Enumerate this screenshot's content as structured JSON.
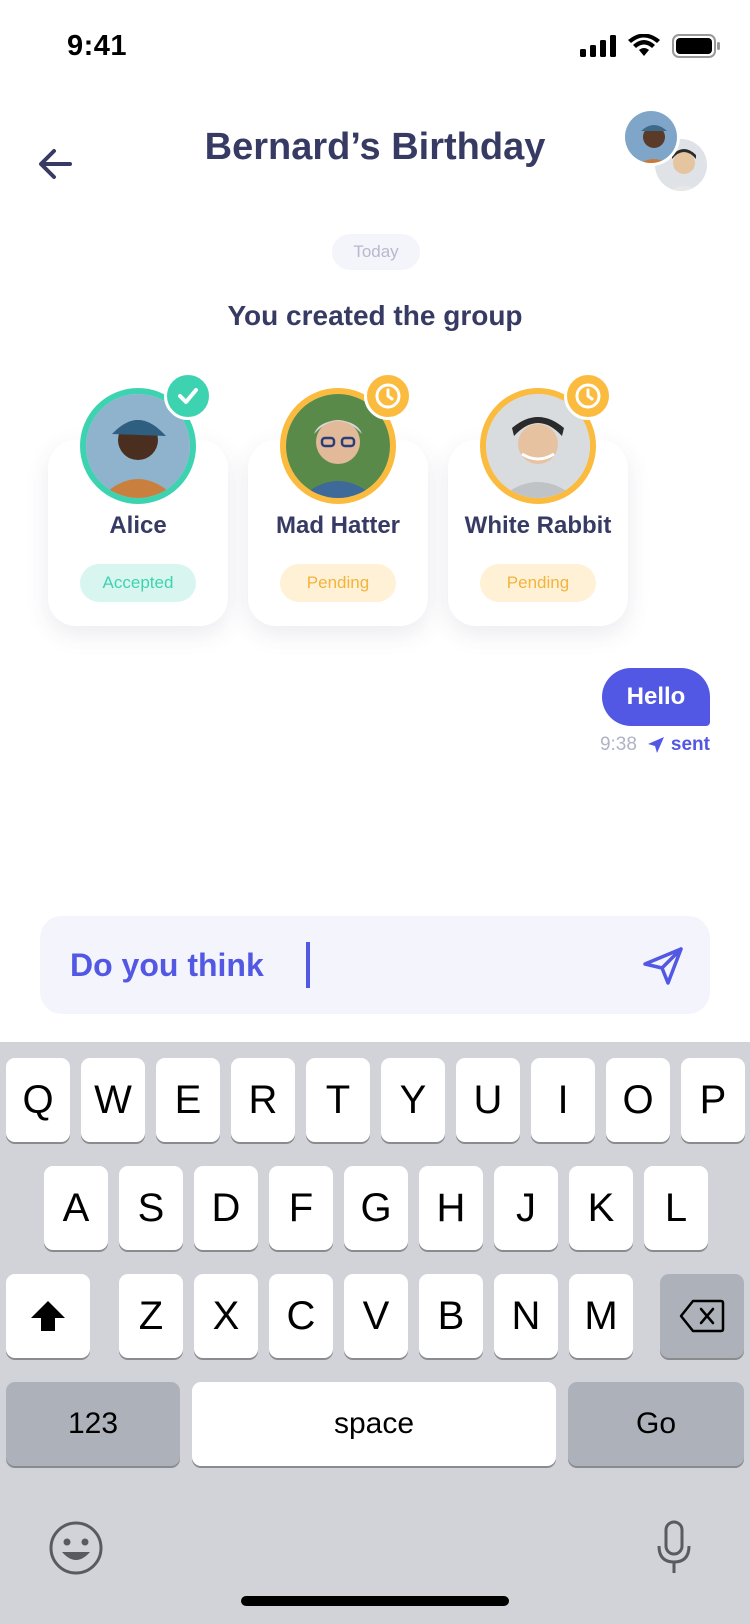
{
  "status_bar": {
    "time": "9:41"
  },
  "header": {
    "title": "Bernard’s Birthday"
  },
  "date_chip": "Today",
  "system_message": "You created the group",
  "members": [
    {
      "name": "Alice",
      "status": "Accepted",
      "state": "accepted"
    },
    {
      "name": "Mad Hatter",
      "status": "Pending",
      "state": "pending"
    },
    {
      "name": "White Rabbit",
      "status": "Pending",
      "state": "pending"
    }
  ],
  "message": {
    "text": "Hello",
    "time": "9:38",
    "state": "sent"
  },
  "composer": {
    "value": "Do you think"
  },
  "keyboard": {
    "row1": [
      "Q",
      "W",
      "E",
      "R",
      "T",
      "Y",
      "U",
      "I",
      "O",
      "P"
    ],
    "row2": [
      "A",
      "S",
      "D",
      "F",
      "G",
      "H",
      "J",
      "K",
      "L"
    ],
    "row3": [
      "Z",
      "X",
      "C",
      "V",
      "B",
      "N",
      "M"
    ],
    "numbers_label": "123",
    "space_label": "space",
    "go_label": "Go"
  },
  "colors": {
    "accent": "#5258e4",
    "accepted": "#3ed3b0",
    "pending": "#fbbb3e",
    "title": "#373b64"
  }
}
